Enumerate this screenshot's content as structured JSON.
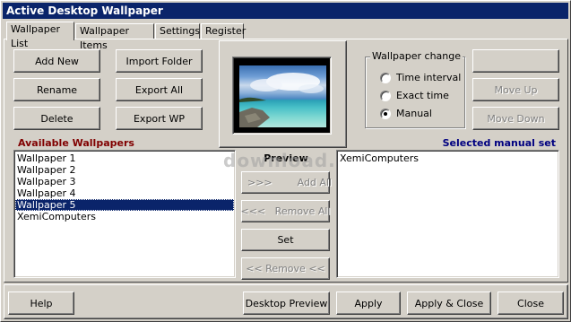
{
  "window": {
    "title": "Active Desktop Wallpaper"
  },
  "tabs": [
    {
      "label": "Wallpaper List",
      "active": true
    },
    {
      "label": "Wallpaper Items",
      "active": false
    },
    {
      "label": "Settings",
      "active": false
    },
    {
      "label": "Register",
      "active": false
    }
  ],
  "buttons": {
    "add_new": "Add New",
    "rename": "Rename",
    "delete": "Delete",
    "import_folder": "Import Folder",
    "export_all": "Export All",
    "export_wp": "Export WP",
    "blank": "",
    "move_up": "Move Up",
    "move_down": "Move Down",
    "add_all": ">>>        Add All",
    "remove_all": "<<<   Remove All",
    "set": "Set",
    "remove": "<< Remove <<"
  },
  "wallpaper_change": {
    "label": "Wallpaper change",
    "options": [
      {
        "label": "Time interval",
        "checked": false
      },
      {
        "label": "Exact time",
        "checked": false
      },
      {
        "label": "Manual",
        "checked": true
      }
    ]
  },
  "available": {
    "heading": "Available Wallpapers",
    "heading_color": "#800000",
    "items": [
      "Wallpaper 1",
      "Wallpaper 2",
      "Wallpaper 3",
      "Wallpaper 4",
      "Wallpaper 5",
      "XemiComputers"
    ],
    "selected_index": 4
  },
  "preview": {
    "heading": "Preview"
  },
  "watermark": "download.sk",
  "selected_set": {
    "heading": "Selected manual set",
    "heading_color": "#000080",
    "items": [
      "XemiComputers"
    ]
  },
  "footer": {
    "help": "Help",
    "desktop_preview": "Desktop Preview",
    "apply": "Apply",
    "apply_close": "Apply & Close",
    "close": "Close"
  }
}
